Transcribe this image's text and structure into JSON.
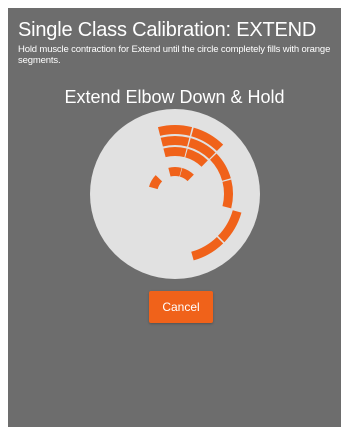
{
  "calibration": {
    "title": "Single Class Calibration: EXTEND",
    "instructions": "Hold muscle contraction for Extend until the circle completely fills with orange segments.",
    "step_label": "Extend Elbow Down & Hold",
    "cancel_label": "Cancel"
  },
  "colors": {
    "panel_background": "#6d6d6d",
    "dial_background": "#e1e1e1",
    "segment_fill": "#f0621a",
    "button_fill": "#f0621a",
    "text": "#ffffff"
  },
  "dial": {
    "rings": [
      {
        "ring": 1,
        "segments_filled": [
          0,
          1,
          4,
          5
        ]
      },
      {
        "ring": 2,
        "segments_filled": [
          0,
          1,
          2,
          3
        ]
      },
      {
        "ring": 3,
        "segments_filled": [
          0,
          1
        ]
      },
      {
        "ring": 4,
        "segments_filled": [
          0,
          1,
          10
        ]
      }
    ],
    "segments_per_ring": 12
  }
}
